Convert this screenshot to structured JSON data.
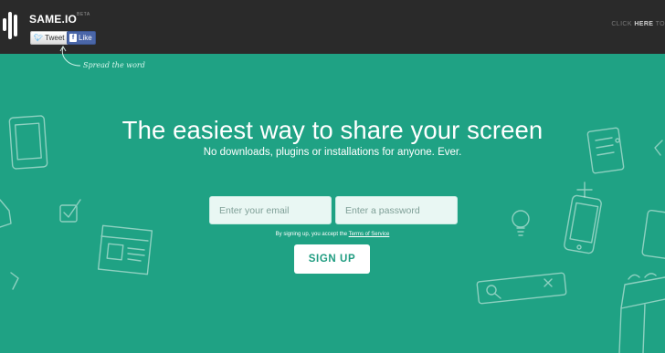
{
  "brand": {
    "name": "SAME.IO",
    "tag": "BETA"
  },
  "social": {
    "tweet_label": "Tweet",
    "like_label": "Like"
  },
  "topbar": {
    "click_prefix": "CLICK ",
    "click_here": "HERE",
    "click_suffix": " TO"
  },
  "spread_note": "Spread the word",
  "hero": {
    "headline": "The easiest way to share your screen",
    "subheadline": "No downloads, plugins or installations for anyone. Ever."
  },
  "form": {
    "email_placeholder": "Enter your email",
    "password_placeholder": "Enter a password",
    "terms_prefix": "By signing up, you accept the ",
    "terms_link": "Terms of Service",
    "signup_label": "SIGN UP"
  },
  "colors": {
    "background": "#1fa284",
    "topbar": "#2a2a2a",
    "button_text": "#1f9c80"
  }
}
